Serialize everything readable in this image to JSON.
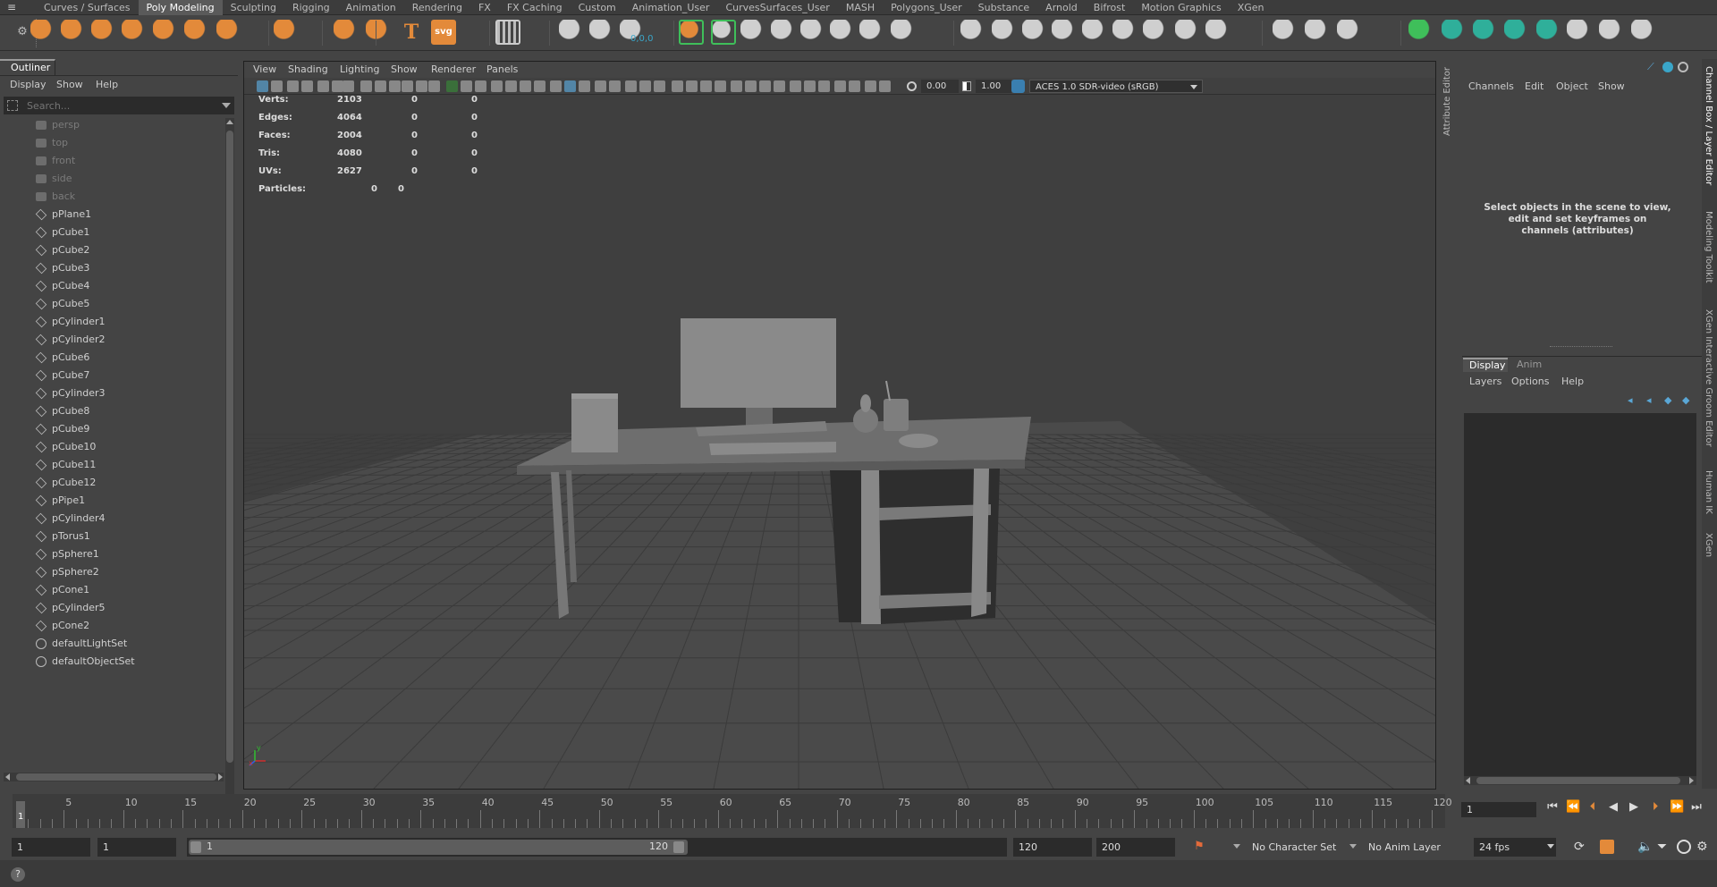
{
  "shelf_tabs": [
    "Curves / Surfaces",
    "Poly Modeling",
    "Sculpting",
    "Rigging",
    "Animation",
    "Rendering",
    "FX",
    "FX Caching",
    "Custom",
    "Animation_User",
    "CurvesSurfaces_User",
    "MASH",
    "Polygons_User",
    "Substance",
    "Arnold",
    "Bifrost",
    "Motion Graphics",
    "XGen"
  ],
  "shelf_active": "Poly Modeling",
  "shelf_numeric": "0,0,0",
  "outliner": {
    "title": "Outliner",
    "menus": [
      "Display",
      "Show",
      "Help"
    ],
    "search_placeholder": "Search...",
    "items": [
      {
        "label": "persp",
        "type": "camera",
        "dim": true
      },
      {
        "label": "top",
        "type": "camera",
        "dim": true
      },
      {
        "label": "front",
        "type": "camera",
        "dim": true
      },
      {
        "label": "side",
        "type": "camera",
        "dim": true
      },
      {
        "label": "back",
        "type": "camera",
        "dim": true
      },
      {
        "label": "pPlane1",
        "type": "mesh"
      },
      {
        "label": "pCube1",
        "type": "mesh"
      },
      {
        "label": "pCube2",
        "type": "mesh"
      },
      {
        "label": "pCube3",
        "type": "mesh"
      },
      {
        "label": "pCube4",
        "type": "mesh"
      },
      {
        "label": "pCube5",
        "type": "mesh"
      },
      {
        "label": "pCylinder1",
        "type": "mesh"
      },
      {
        "label": "pCylinder2",
        "type": "mesh"
      },
      {
        "label": "pCube6",
        "type": "mesh"
      },
      {
        "label": "pCube7",
        "type": "mesh"
      },
      {
        "label": "pCylinder3",
        "type": "mesh"
      },
      {
        "label": "pCube8",
        "type": "mesh"
      },
      {
        "label": "pCube9",
        "type": "mesh"
      },
      {
        "label": "pCube10",
        "type": "mesh"
      },
      {
        "label": "pCube11",
        "type": "mesh"
      },
      {
        "label": "pCube12",
        "type": "mesh"
      },
      {
        "label": "pPipe1",
        "type": "mesh"
      },
      {
        "label": "pCylinder4",
        "type": "mesh"
      },
      {
        "label": "pTorus1",
        "type": "mesh"
      },
      {
        "label": "pSphere1",
        "type": "mesh"
      },
      {
        "label": "pSphere2",
        "type": "mesh"
      },
      {
        "label": "pCone1",
        "type": "mesh"
      },
      {
        "label": "pCylinder5",
        "type": "mesh"
      },
      {
        "label": "pCone2",
        "type": "mesh"
      },
      {
        "label": "defaultLightSet",
        "type": "set"
      },
      {
        "label": "defaultObjectSet",
        "type": "set"
      }
    ]
  },
  "viewport": {
    "menus": [
      "View",
      "Shading",
      "Lighting",
      "Show",
      "Renderer",
      "Panels"
    ],
    "exposure": "0.00",
    "gamma": "1.00",
    "colorspace": "ACES 1.0 SDR-video (sRGB)",
    "hud": [
      {
        "label": "Verts:",
        "a": "2103",
        "b": "0",
        "c": "0"
      },
      {
        "label": "Edges:",
        "a": "4064",
        "b": "0",
        "c": "0"
      },
      {
        "label": "Faces:",
        "a": "2004",
        "b": "0",
        "c": "0"
      },
      {
        "label": "Tris:",
        "a": "4080",
        "b": "0",
        "c": "0"
      },
      {
        "label": "UVs:",
        "a": "2627",
        "b": "0",
        "c": "0"
      }
    ],
    "particles": {
      "label": "Particles:",
      "a": "0",
      "b": "0"
    },
    "axis": {
      "x": "x",
      "y": "y",
      "z": "z"
    }
  },
  "side_tabs_left": [
    "Attribute Editor"
  ],
  "side_tabs_right": [
    "Channel Box / Layer Editor",
    "Modeling Toolkit",
    "XGen Interactive Groom Editor",
    "Human IK",
    "XGen"
  ],
  "channel_box": {
    "menus": [
      "Channels",
      "Edit",
      "Object",
      "Show"
    ],
    "message": "Select objects in the scene to view, edit and set keyframes on channels (attributes)"
  },
  "layer_editor": {
    "tabs": [
      "Display",
      "Anim"
    ],
    "active_tab": "Display",
    "menus": [
      "Layers",
      "Options",
      "Help"
    ]
  },
  "timeline": {
    "ticks": [
      "5",
      "10",
      "15",
      "20",
      "25",
      "30",
      "35",
      "40",
      "45",
      "50",
      "55",
      "60",
      "65",
      "70",
      "75",
      "80",
      "85",
      "90",
      "95",
      "100",
      "105",
      "110",
      "115",
      "120"
    ],
    "current_frame_marker": "1",
    "current_frame": "1"
  },
  "range": {
    "start": "1",
    "anim_start": "1",
    "slider_start": "1",
    "slider_end": "120",
    "end": "120",
    "anim_end": "200",
    "character_set": "No Character Set",
    "anim_layer": "No Anim Layer",
    "fps": "24 fps"
  },
  "colors": {
    "accent": "#e38a3a",
    "select": "#5285a6",
    "green_bracket": "#3fbf5a",
    "cyan": "#3aa6c9"
  }
}
